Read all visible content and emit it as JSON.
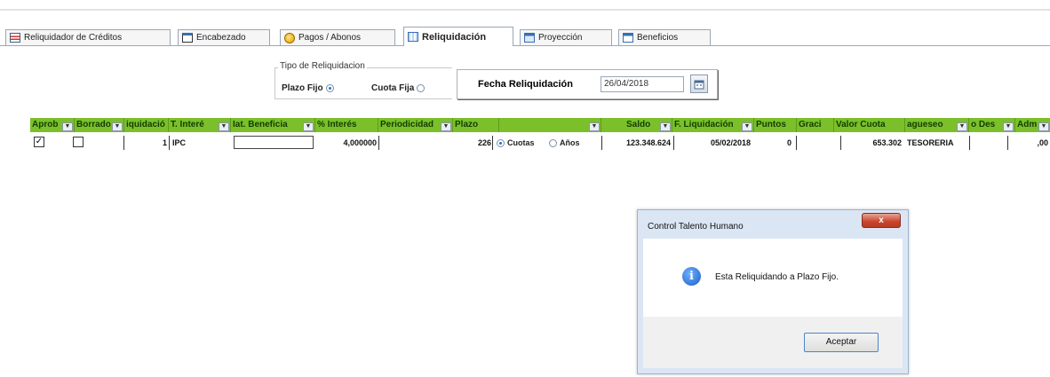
{
  "tabs": [
    {
      "label": "Reliquidador de Créditos",
      "icon": "table-icon"
    },
    {
      "label": "Encabezado",
      "icon": "form-icon"
    },
    {
      "label": "Pagos / Abonos",
      "icon": "payment-icon"
    },
    {
      "label": "Reliquidación",
      "icon": "grid-icon",
      "active": true
    },
    {
      "label": "Proyección",
      "icon": "projection-icon"
    },
    {
      "label": "Beneficios",
      "icon": "benefits-icon"
    }
  ],
  "tipo": {
    "legend": "Tipo de Reliquidacion",
    "plazo_fijo_label": "Plazo Fijo",
    "cuota_fija_label": "Cuota Fija",
    "selected": "Plazo Fijo"
  },
  "fecha": {
    "label": "Fecha Reliquidación",
    "value": "26/04/2018"
  },
  "grid": {
    "headers": [
      "Aprob",
      "Borrado",
      "iquidació",
      "T. Interé",
      "Iat. Beneficia",
      "% Interés",
      "Periodicidad",
      "Plazo",
      "",
      "Saldo",
      "F. Liquidación",
      "Puntos",
      "Graci",
      "Valor Cuota",
      "agueseo",
      "o Des",
      "Adm"
    ],
    "row": {
      "aprob_checked": true,
      "borrado_checked": false,
      "liquidacion": "1",
      "t_interes": "IPC",
      "interes_pct": "4,000000",
      "plazo": "226",
      "cuotas_label": "Cuotas",
      "anos_label": "Años",
      "plazo_unit": "Cuotas",
      "saldo": "123.348.624",
      "f_liquidacion": "05/02/2018",
      "puntos": "0",
      "valor_cuota": "653.302",
      "paguese": "TESORERIA",
      "adm": ",00"
    }
  },
  "dialog": {
    "title": "Control Talento Humano",
    "close_label": "x",
    "message": "Esta Reliquidando a Plazo Fijo.",
    "ok_label": "Aceptar"
  }
}
